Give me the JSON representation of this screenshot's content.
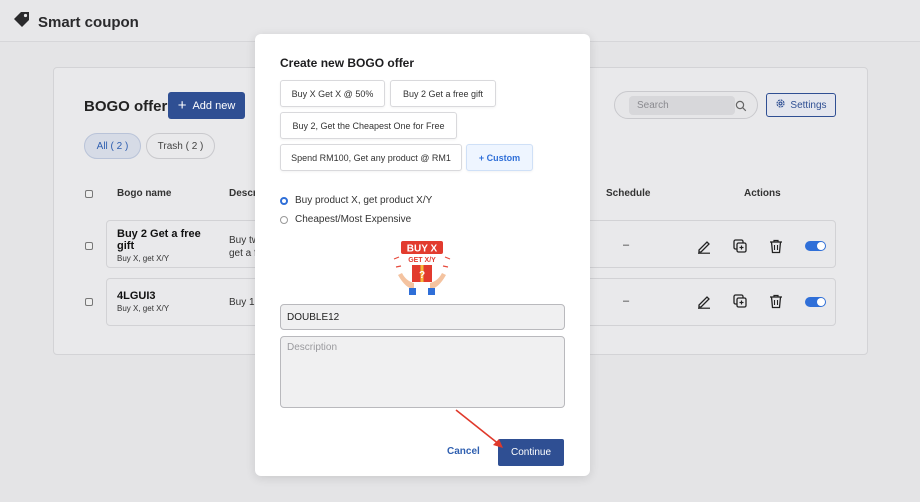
{
  "app": {
    "title": "Smart coupon",
    "logo_icon": "tag-icon"
  },
  "page": {
    "title": "BOGO offers",
    "add_button": "Add new",
    "search_placeholder": "Search",
    "settings_label": "Settings",
    "filters": {
      "all": "All ( 2 )",
      "trash": "Trash ( 2 )"
    },
    "columns": {
      "name": "Bogo name",
      "description": "Descr",
      "schedule": "Schedule",
      "actions": "Actions"
    },
    "rows": [
      {
        "name": "Buy 2 Get a free gift",
        "subtitle": "Buy X, get X/Y",
        "description_line1": "Buy tw",
        "description_line2": "get a f",
        "schedule": "–"
      },
      {
        "name": "4LGUI3",
        "subtitle": "Buy X, get X/Y",
        "description_line1": "Buy 1",
        "description_line2": "",
        "schedule": "–"
      }
    ]
  },
  "modal": {
    "title": "Create new BOGO offer",
    "templates": [
      "Buy X Get X @ 50%",
      "Buy 2 Get a free gift",
      "Buy 2, Get the Cheapest One for Free",
      "Spend RM100, Get any product @ RM1",
      "+ Custom"
    ],
    "options": [
      {
        "label": "Buy product X, get product X/Y",
        "selected": true
      },
      {
        "label": "Cheapest/Most Expensive",
        "selected": false
      }
    ],
    "gift_image_text": {
      "line1": "BUY X",
      "line2": "GET X/Y",
      "mark": "?"
    },
    "code_value": "DOUBLE12",
    "description_placeholder": "Description",
    "cancel_label": "Cancel",
    "continue_label": "Continue"
  },
  "colors": {
    "primary": "#2f4f93",
    "accent": "#2f6fd8",
    "arrow": "#e0392b"
  }
}
